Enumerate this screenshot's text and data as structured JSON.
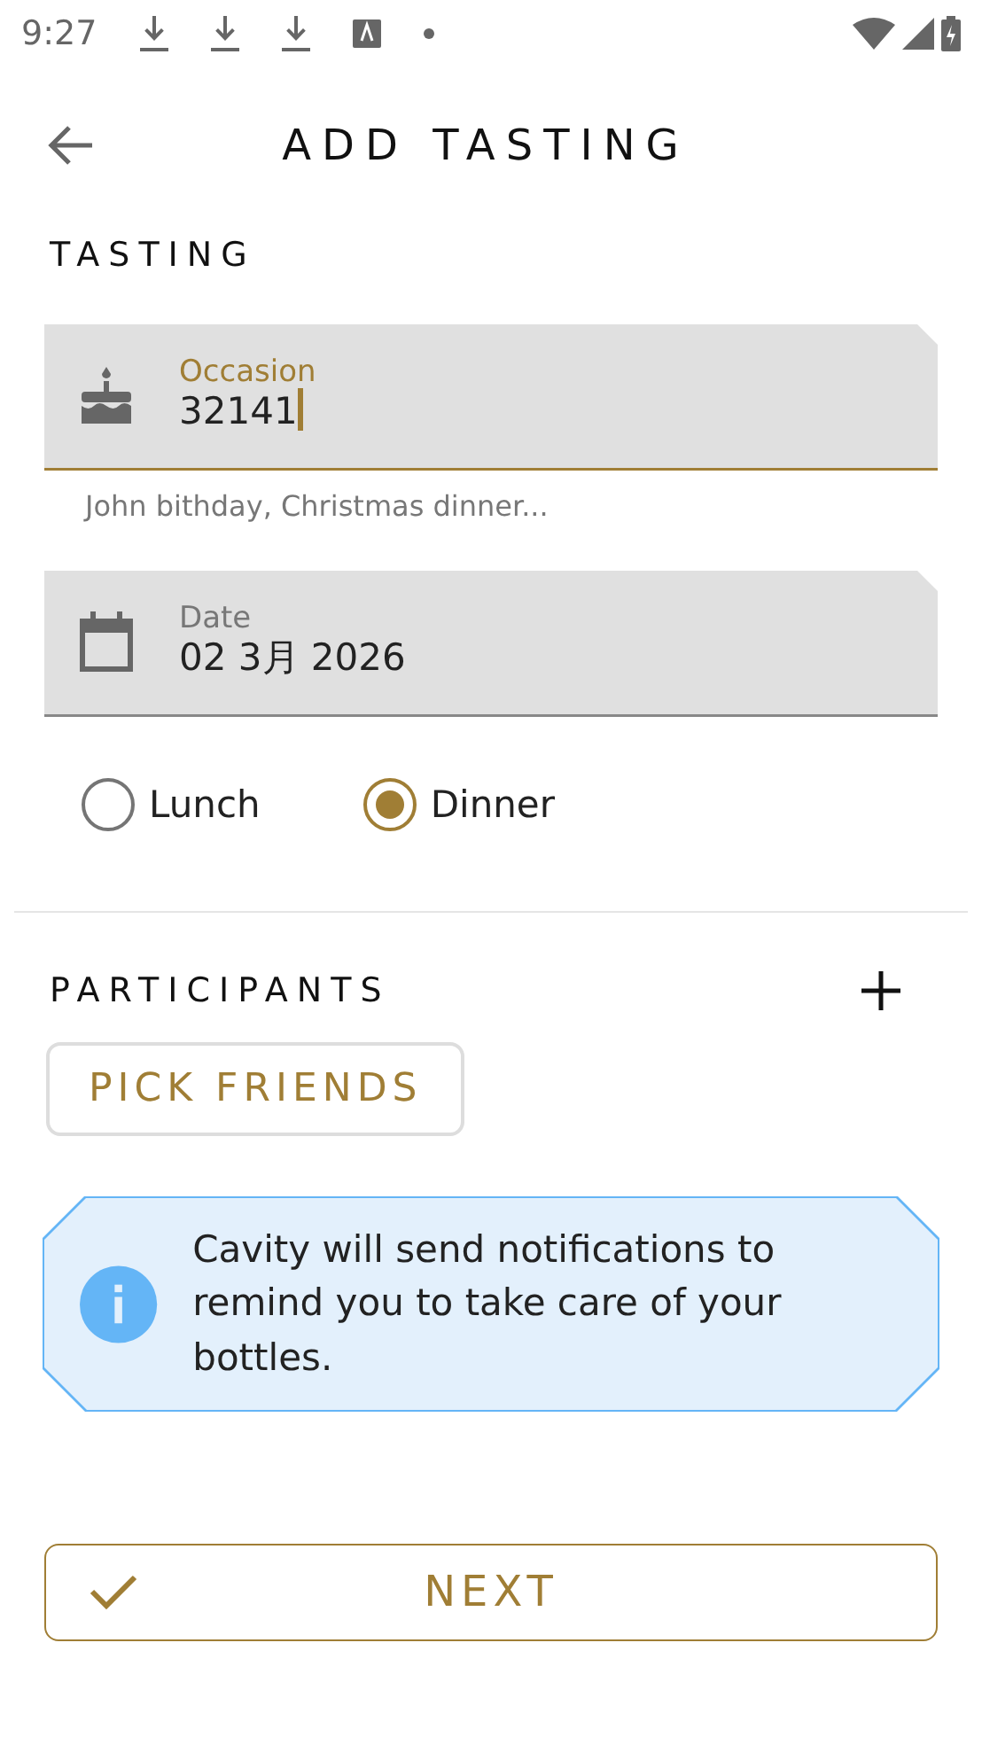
{
  "status_bar": {
    "time": "9:27"
  },
  "header": {
    "title": "ADD TASTING"
  },
  "tasting_section": {
    "title": "TASTING",
    "occasion": {
      "label": "Occasion",
      "value": "32141",
      "focused": true,
      "helper": "John bithday, Christmas dinner..."
    },
    "date": {
      "label": "Date",
      "value": "02 3月 2026",
      "focused": false
    },
    "meal": [
      {
        "label": "Lunch",
        "selected": false
      },
      {
        "label": "Dinner",
        "selected": true
      }
    ]
  },
  "participants": {
    "title": "PARTICIPANTS",
    "pick_button": "PICK FRIENDS"
  },
  "info": {
    "text": "Cavity will send notifications to remind you to take care of your bottles."
  },
  "next_button": "NEXT"
}
